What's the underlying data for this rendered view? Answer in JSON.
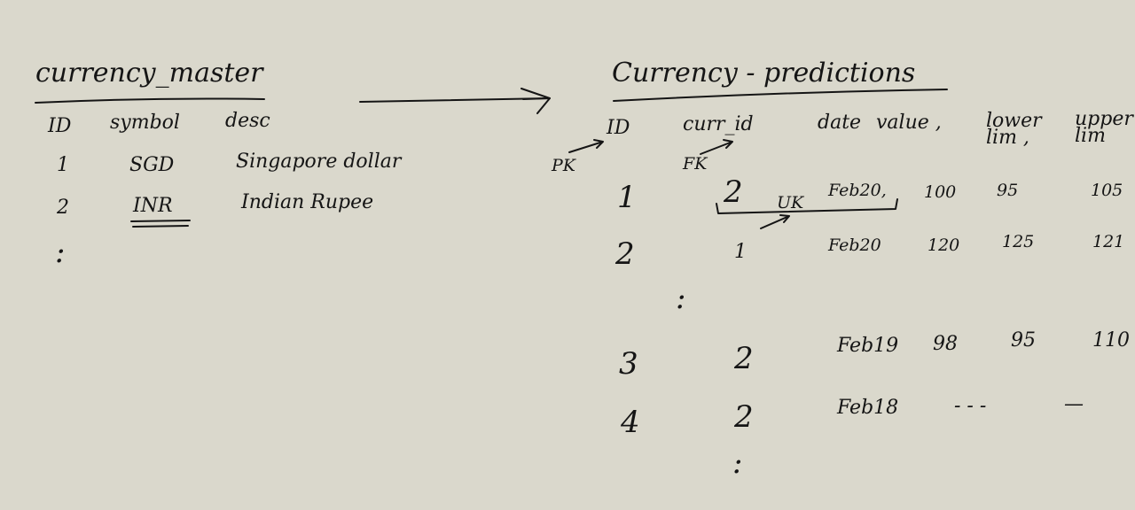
{
  "colors": {
    "background": "#dad8cc",
    "ink": "#151515"
  },
  "left_table": {
    "title": "currency_master",
    "headers": [
      "ID",
      "symbol",
      "desc"
    ],
    "rows": [
      [
        "1",
        "SGD",
        "Singapore dollar"
      ],
      [
        "2",
        "INR",
        "Indian Rupee"
      ]
    ],
    "continuation": ":"
  },
  "relationship": {
    "type": "one-to-many (crow's foot)"
  },
  "right_table": {
    "title": "Currency - predictions",
    "headers": [
      "ID",
      "curr_id",
      "date",
      "value ,",
      "lower lim ,",
      "upper lim"
    ],
    "annotations": {
      "pk": "PK",
      "fk": "FK",
      "uk": "UK"
    },
    "rows": [
      [
        "1",
        "2",
        "Feb20,",
        "100",
        "95",
        "105"
      ],
      [
        "2",
        "1",
        "Feb20",
        "120",
        "125",
        "121"
      ],
      [
        "3",
        "2",
        "Feb19",
        "98",
        "95",
        "110"
      ],
      [
        "4",
        "2",
        "Feb18",
        "- - -",
        "",
        "—"
      ]
    ],
    "continuation": ":"
  }
}
